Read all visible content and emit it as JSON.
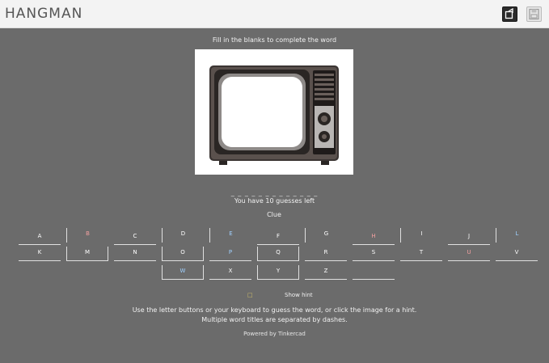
{
  "app": {
    "title": "HANGMAN"
  },
  "toolbar": {
    "share_icon": "share-icon",
    "save_icon": "save-icon"
  },
  "game": {
    "category": "Fill in the blanks to complete the word",
    "picture_icon": "retro-television",
    "word_slots": "_ _ _ _ _ _ _ _ _ _ _ _ _",
    "guesses_left": "You have 10 guesses left",
    "clue_label": "Clue"
  },
  "keyboard": {
    "row1": [
      "A",
      "B",
      "C",
      "D",
      "E",
      "F",
      "G",
      "H",
      "I",
      "J",
      "K",
      "L"
    ],
    "row2": [
      "M",
      "N",
      "O",
      "P",
      "Q",
      "R",
      "S",
      "T",
      "U",
      "V",
      "W"
    ],
    "row3": [
      "X",
      "Y",
      "Z",
      "",
      ""
    ],
    "letter_colors": [
      "#ffffff",
      "#f2a0a0",
      "#ffffff",
      "#ffffff",
      "#9fd0ff",
      "#ffffff",
      "#ffffff",
      "#f2a0a0",
      "#ffffff",
      "#ffffff",
      "#ffffff",
      "#9fd0ff"
    ]
  },
  "hint": {
    "toggle": "□",
    "label": "Show hint"
  },
  "instructions": {
    "line1": "Use the letter buttons or your keyboard to guess the word, or click the image for a hint.",
    "line2": "Multiple word titles are separated by dashes."
  },
  "credit": "Powered by Tinkercad"
}
